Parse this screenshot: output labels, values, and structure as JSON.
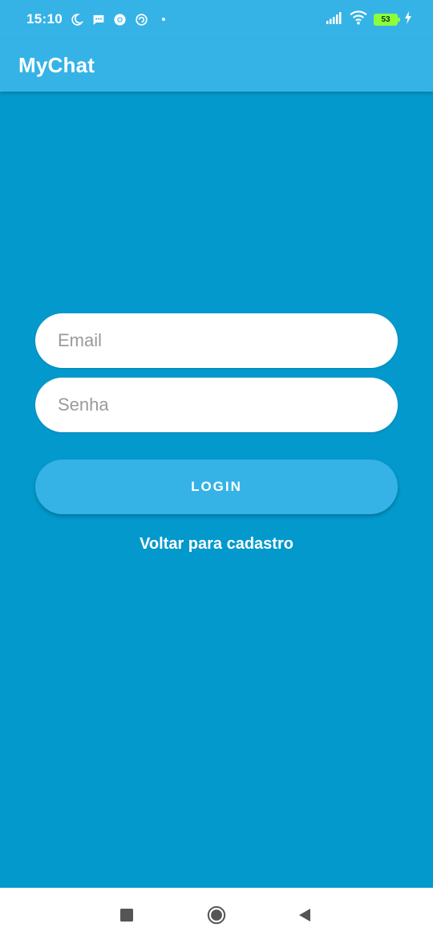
{
  "status_bar": {
    "time": "15:10",
    "left_icons": [
      "moon-icon",
      "message-icon",
      "chrome-icon",
      "vpn-icon",
      "dot-icon"
    ],
    "right_icons": [
      "signal-icon",
      "wifi-icon",
      "battery-icon",
      "charging-icon"
    ],
    "battery_level": "53",
    "battery_color": "#8dff3a"
  },
  "app_bar": {
    "title": "MyChat",
    "color": "#35b3e6"
  },
  "form": {
    "email_placeholder": "Email",
    "email_value": "",
    "password_placeholder": "Senha",
    "password_value": "",
    "login_label": "LOGIN",
    "register_link": "Voltar para cadastro"
  },
  "colors": {
    "background": "#0399cc",
    "primary": "#35b3e6",
    "field_background": "#ffffff",
    "nav_background": "#ffffff"
  },
  "nav_bar": {
    "buttons": [
      "recent-apps-button",
      "home-button",
      "back-button"
    ]
  }
}
